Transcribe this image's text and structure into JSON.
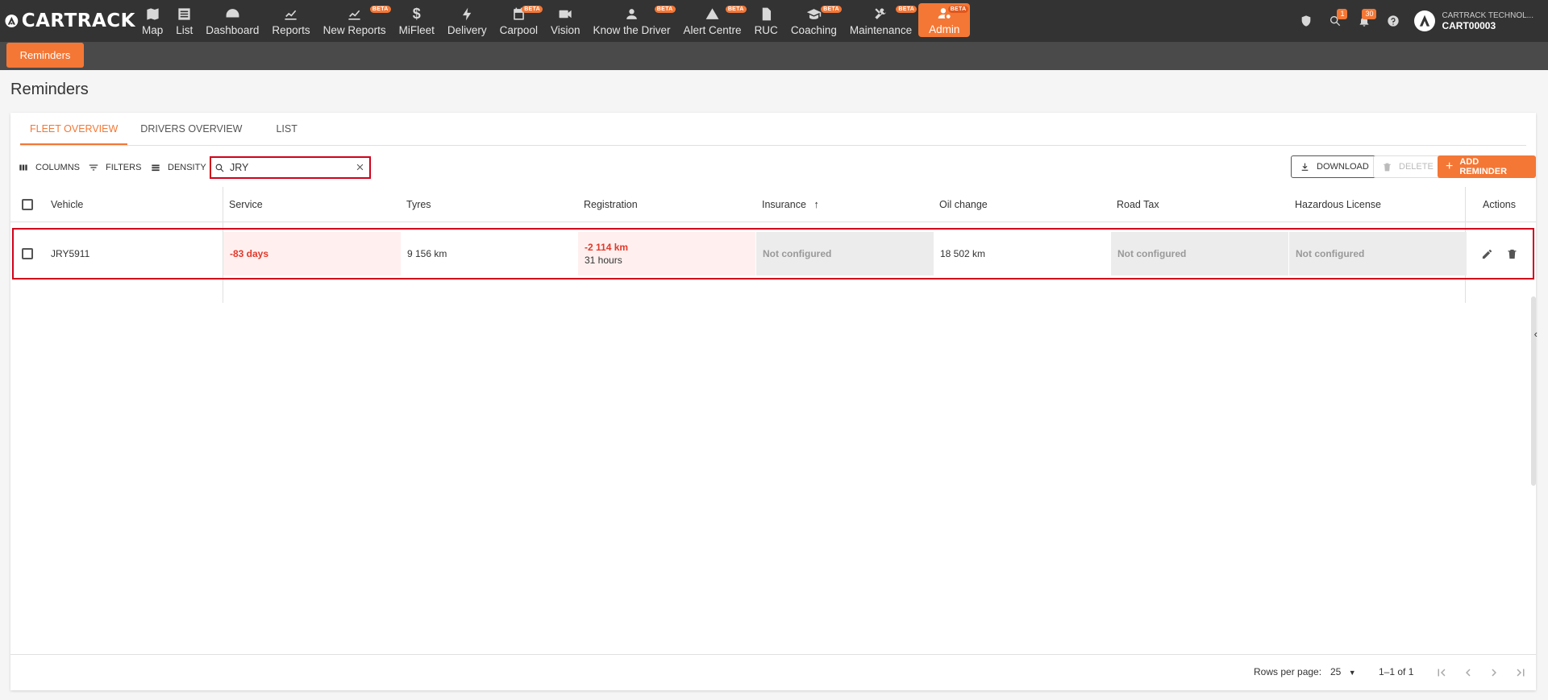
{
  "app": {
    "brand": "CARTRACK"
  },
  "nav": {
    "items": [
      {
        "label": "Map",
        "icon": "map-icon",
        "beta": ""
      },
      {
        "label": "List",
        "icon": "list-icon",
        "beta": ""
      },
      {
        "label": "Dashboard",
        "icon": "dashboard-icon",
        "beta": ""
      },
      {
        "label": "Reports",
        "icon": "reports-icon",
        "beta": ""
      },
      {
        "label": "New Reports",
        "icon": "new-reports-icon",
        "beta": "BETA"
      },
      {
        "label": "MiFleet",
        "icon": "dollar-icon",
        "beta": ""
      },
      {
        "label": "Delivery",
        "icon": "bolt-icon",
        "beta": ""
      },
      {
        "label": "Carpool",
        "icon": "calendar-icon",
        "beta": "BETA"
      },
      {
        "label": "Vision",
        "icon": "video-icon",
        "beta": ""
      },
      {
        "label": "Know the Driver",
        "icon": "driver-icon",
        "beta": "BETA"
      },
      {
        "label": "Alert Centre",
        "icon": "alert-icon",
        "beta": "BETA"
      },
      {
        "label": "RUC",
        "icon": "document-icon",
        "beta": ""
      },
      {
        "label": "Coaching",
        "icon": "graduation-icon",
        "beta": "BETA"
      },
      {
        "label": "Maintenance",
        "icon": "tools-icon",
        "beta": "BETA"
      },
      {
        "label": "Admin",
        "icon": "admin-icon",
        "beta": "BETA"
      }
    ],
    "badges": {
      "search": "1",
      "notifications": "30"
    },
    "user": {
      "company": "CARTRACK TECHNOL...",
      "code": "CART00003"
    }
  },
  "subnav": {
    "tab": "Reminders"
  },
  "page": {
    "title": "Reminders",
    "tabs": [
      "FLEET OVERVIEW",
      "DRIVERS OVERVIEW",
      "LIST"
    ]
  },
  "toolbar": {
    "columns": "COLUMNS",
    "filters": "FILTERS",
    "density": "DENSITY",
    "search_value": "JRY",
    "download": "DOWNLOAD",
    "delete": "DELETE",
    "add_reminder": "ADD REMINDER"
  },
  "table": {
    "headers": [
      "Vehicle",
      "Service",
      "Tyres",
      "Registration",
      "Insurance",
      "Oil change",
      "Road Tax",
      "Hazardous License",
      "Actions"
    ],
    "rows": [
      {
        "vehicle": "JRY5911",
        "service": "-83 days",
        "tyres": "9 156 km",
        "registration": "-2 114 km",
        "registration_sub": "31 hours",
        "insurance": "Not configured",
        "oil_change": "18 502 km",
        "road_tax": "Not configured",
        "hazardous_license": "Not configured"
      }
    ]
  },
  "footer": {
    "rows_per_page_label": "Rows per page:",
    "rows_per_page_value": "25",
    "range": "1–1 of 1"
  },
  "colors": {
    "accent": "#f47735",
    "nav_bg": "#333333",
    "highlight": "#d0021b",
    "overdue": "#e0392b"
  }
}
